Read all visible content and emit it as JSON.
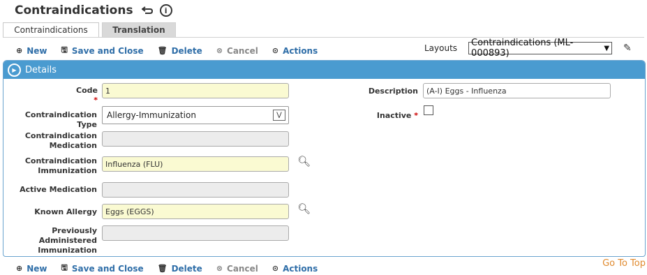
{
  "page": {
    "title": "Contraindications"
  },
  "tabs": [
    {
      "label": "Contraindications"
    },
    {
      "label": "Translation"
    }
  ],
  "toolbar": {
    "new": "New",
    "save_close": "Save and Close",
    "delete": "Delete",
    "cancel": "Cancel",
    "actions": "Actions"
  },
  "layouts": {
    "label": "Layouts",
    "value": "Contraindications (ML-000893)"
  },
  "section": {
    "title": "Details"
  },
  "form": {
    "code": {
      "label": "Code",
      "value": "1"
    },
    "type": {
      "label": "Contraindication Type",
      "value": "Allergy-Immunization"
    },
    "med": {
      "label1": "Contraindication",
      "label2": "Medication",
      "value": ""
    },
    "imm": {
      "label1": "Contraindication",
      "label2": "Immunization",
      "value": "Influenza (FLU)"
    },
    "active_med": {
      "label": "Active Medication",
      "value": ""
    },
    "allergy": {
      "label": "Known Allergy",
      "value": "Eggs (EGGS)"
    },
    "prev": {
      "label1": "Previously",
      "label2": "Administered",
      "label3": "Immunization",
      "value": ""
    },
    "description": {
      "label": "Description",
      "value": "(A-I) Eggs - Influenza"
    },
    "inactive": {
      "label": "Inactive",
      "checked": false
    }
  },
  "footer": {
    "go_to_top": "Go To Top"
  }
}
